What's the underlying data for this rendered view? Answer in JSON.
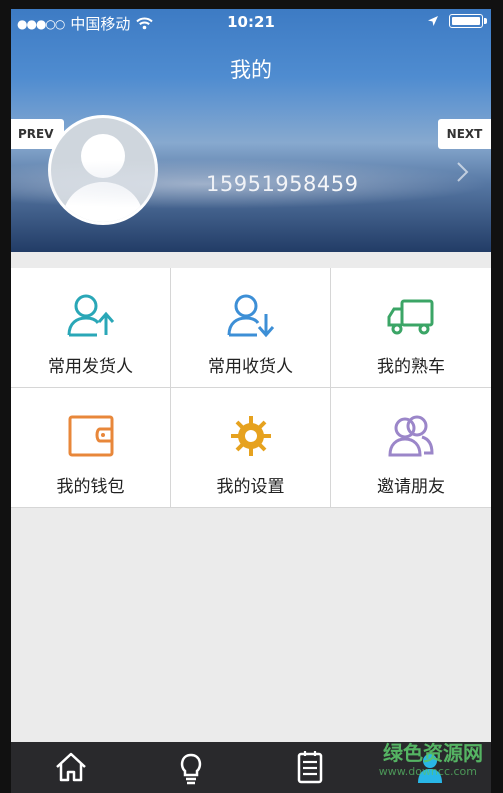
{
  "status_bar": {
    "carrier": "中国移动",
    "time": "10:21"
  },
  "header": {
    "title": "我的",
    "phone": "15951958459",
    "prev_label": "PREV",
    "next_label": "NEXT"
  },
  "menu": [
    {
      "label": "常用发货人",
      "icon": "user-upload-icon",
      "color": "#2aa7b7"
    },
    {
      "label": "常用收货人",
      "icon": "user-download-icon",
      "color": "#3d8fd6"
    },
    {
      "label": "我的熟车",
      "icon": "truck-icon",
      "color": "#3ba566"
    },
    {
      "label": "我的钱包",
      "icon": "wallet-icon",
      "color": "#e8873a"
    },
    {
      "label": "我的设置",
      "icon": "gear-icon",
      "color": "#e6a21f"
    },
    {
      "label": "邀请朋友",
      "icon": "friends-icon",
      "color": "#9b86c9"
    }
  ],
  "tabbar": [
    "home-icon",
    "bulb-icon",
    "notepad-icon",
    "person-icon"
  ],
  "watermark": {
    "main": "绿色资源网",
    "sub": "www.downcc.com"
  }
}
